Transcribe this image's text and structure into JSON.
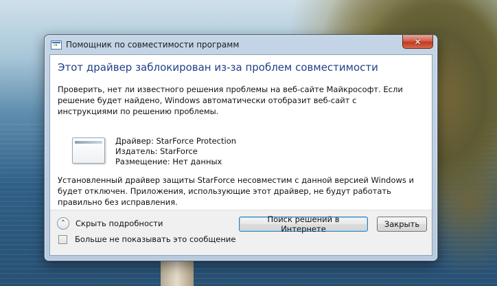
{
  "window": {
    "title": "Помощник по совместимости программ",
    "close_glyph": "✕"
  },
  "content": {
    "heading": "Этот драйвер заблокирован из-за проблем совместимости",
    "intro": "Проверить, нет ли известного решения проблемы на веб-сайте Майкрософт. Если решение будет найдено, Windows автоматически отобразит веб-сайт с инструкциями по решению проблемы.",
    "driver_line": "Драйвер: StarForce Protection",
    "publisher_line": "Издатель: StarForce",
    "location_line": "Размещение: Нет данных",
    "explanation": "Установленный драйвер защиты StarForce несовместим с данной версией Windows и будет отключен.  Приложения, использующие этот драйвер, не будут работать правильно без исправления."
  },
  "footer": {
    "toggle_glyph": "⌃",
    "toggle_label": "Скрыть подробности",
    "search_button": "Поиск решений в Интернете",
    "close_button": "Закрыть",
    "checkbox_label": "Больше не показывать это сообщение"
  },
  "icons": {
    "title": "compatibility-assistant-icon",
    "driver": "driver-window-icon",
    "toggle": "chevron-up-icon"
  }
}
